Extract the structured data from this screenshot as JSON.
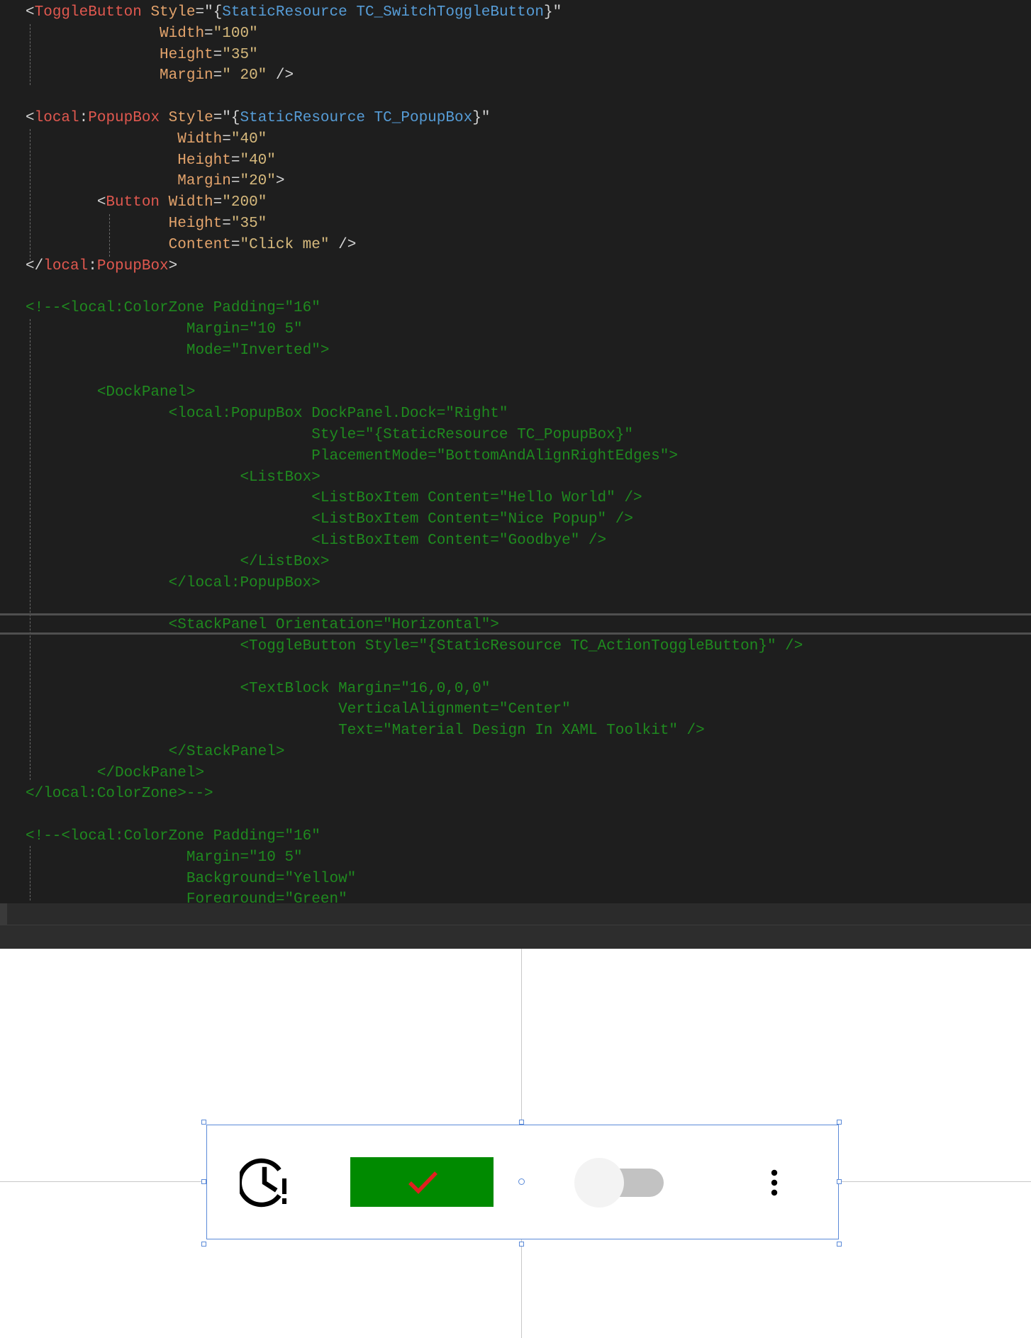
{
  "editor": {
    "lines": [
      [
        [
          "pun",
          "<"
        ],
        [
          "tag",
          "ToggleButton"
        ],
        [
          "attr",
          " Style"
        ],
        [
          "pun",
          "=\""
        ],
        [
          "pun",
          "{"
        ],
        [
          "res",
          "StaticResource"
        ],
        [
          "res",
          " TC_SwitchToggleButton"
        ],
        [
          "pun",
          "}\""
        ]
      ],
      [
        [
          "attr",
          "               Width"
        ],
        [
          "pun",
          "="
        ],
        [
          "str",
          "\"100\""
        ]
      ],
      [
        [
          "attr",
          "               Height"
        ],
        [
          "pun",
          "="
        ],
        [
          "str",
          "\"35\""
        ]
      ],
      [
        [
          "attr",
          "               Margin"
        ],
        [
          "pun",
          "="
        ],
        [
          "str",
          "\" 20\""
        ],
        [
          "pun",
          " />"
        ]
      ],
      [
        [
          "pun",
          ""
        ]
      ],
      [
        [
          "pun",
          "<"
        ],
        [
          "tag",
          "local"
        ],
        [
          "pun",
          ":"
        ],
        [
          "tag",
          "PopupBox"
        ],
        [
          "attr",
          " Style"
        ],
        [
          "pun",
          "=\""
        ],
        [
          "pun",
          "{"
        ],
        [
          "res",
          "StaticResource"
        ],
        [
          "res",
          " TC_PopupBox"
        ],
        [
          "pun",
          "}\""
        ]
      ],
      [
        [
          "attr",
          "                 Width"
        ],
        [
          "pun",
          "="
        ],
        [
          "str",
          "\"40\""
        ]
      ],
      [
        [
          "attr",
          "                 Height"
        ],
        [
          "pun",
          "="
        ],
        [
          "str",
          "\"40\""
        ]
      ],
      [
        [
          "attr",
          "                 Margin"
        ],
        [
          "pun",
          "="
        ],
        [
          "str",
          "\"20\""
        ],
        [
          "pun",
          ">"
        ]
      ],
      [
        [
          "pun",
          "        <"
        ],
        [
          "tag",
          "Button"
        ],
        [
          "attr",
          " Width"
        ],
        [
          "pun",
          "="
        ],
        [
          "str",
          "\"200\""
        ]
      ],
      [
        [
          "attr",
          "                Height"
        ],
        [
          "pun",
          "="
        ],
        [
          "str",
          "\"35\""
        ]
      ],
      [
        [
          "attr",
          "                Content"
        ],
        [
          "pun",
          "="
        ],
        [
          "str",
          "\"Click me\""
        ],
        [
          "pun",
          " />"
        ]
      ],
      [
        [
          "pun",
          "</"
        ],
        [
          "tag",
          "local"
        ],
        [
          "pun",
          ":"
        ],
        [
          "tag",
          "PopupBox"
        ],
        [
          "pun",
          ">"
        ]
      ],
      [
        [
          "pun",
          ""
        ]
      ],
      [
        [
          "cmt",
          "<!--<local:ColorZone Padding=\"16\""
        ]
      ],
      [
        [
          "cmt",
          "                  Margin=\"10 5\""
        ]
      ],
      [
        [
          "cmt",
          "                  Mode=\"Inverted\">"
        ]
      ],
      [
        [
          "pun",
          ""
        ]
      ],
      [
        [
          "cmt",
          "        <DockPanel>"
        ]
      ],
      [
        [
          "cmt",
          "                <local:PopupBox DockPanel.Dock=\"Right\""
        ]
      ],
      [
        [
          "cmt",
          "                                Style=\"{StaticResource TC_PopupBox}\""
        ]
      ],
      [
        [
          "cmt",
          "                                PlacementMode=\"BottomAndAlignRightEdges\">"
        ]
      ],
      [
        [
          "cmt",
          "                        <ListBox>"
        ]
      ],
      [
        [
          "cmt",
          "                                <ListBoxItem Content=\"Hello World\" />"
        ]
      ],
      [
        [
          "cmt",
          "                                <ListBoxItem Content=\"Nice Popup\" />"
        ]
      ],
      [
        [
          "cmt",
          "                                <ListBoxItem Content=\"Goodbye\" />"
        ]
      ],
      [
        [
          "cmt",
          "                        </ListBox>"
        ]
      ],
      [
        [
          "cmt",
          "                </local:PopupBox>"
        ]
      ],
      [
        [
          "pun",
          ""
        ]
      ],
      [
        [
          "cmt",
          "                <StackPanel Orientation=\"Horizontal\">"
        ]
      ],
      [
        [
          "cmt",
          "                        <ToggleButton Style=\"{StaticResource TC_ActionToggleButton}\" />"
        ]
      ],
      [
        [
          "pun",
          ""
        ]
      ],
      [
        [
          "cmt",
          "                        <TextBlock Margin=\"16,0,0,0\""
        ]
      ],
      [
        [
          "cmt",
          "                                   VerticalAlignment=\"Center\""
        ]
      ],
      [
        [
          "cmt",
          "                                   Text=\"Material Design In XAML Toolkit\" />"
        ]
      ],
      [
        [
          "cmt",
          "                </StackPanel>"
        ]
      ],
      [
        [
          "cmt",
          "        </DockPanel>"
        ]
      ],
      [
        [
          "cmt",
          "</local:ColorZone>-->"
        ]
      ],
      [
        [
          "pun",
          ""
        ]
      ],
      [
        [
          "cmt",
          "<!--<local:ColorZone Padding=\"16\""
        ]
      ],
      [
        [
          "cmt",
          "                  Margin=\"10 5\""
        ]
      ],
      [
        [
          "cmt",
          "                  Background=\"Yellow\""
        ]
      ],
      [
        [
          "cmt",
          "                  Foreground=\"Green\""
        ]
      ]
    ]
  },
  "designer": {
    "icons": {
      "clock": "clock-alert-icon",
      "check": "check-icon",
      "dots": "dots-vertical-icon"
    },
    "action_toggle": {
      "checked": true,
      "background": "#008a00",
      "check_color": "#e02020"
    },
    "switch_toggle": {
      "checked": false
    },
    "colors": {
      "selection": "#5b8ad8",
      "editor_bg": "#1e1e1e"
    }
  }
}
